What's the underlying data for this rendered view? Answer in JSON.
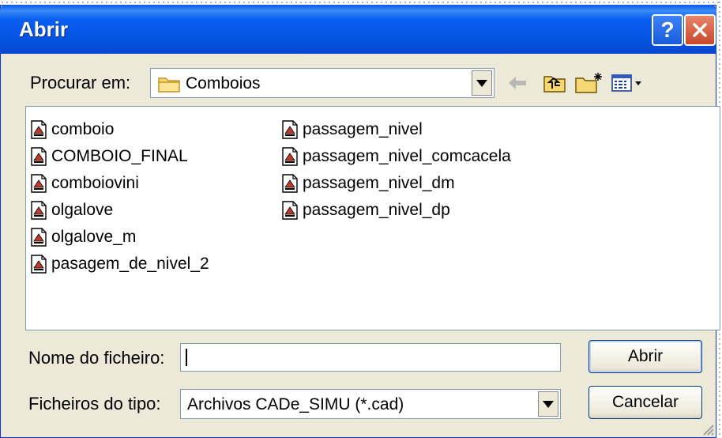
{
  "window": {
    "title": "Abrir",
    "help_icon": "?",
    "close_icon": "close-icon"
  },
  "lookin": {
    "label": "Procurar em:",
    "value": "Comboios",
    "icon": "folder-icon"
  },
  "toolbar": {
    "back_icon": "back-arrow-icon",
    "up_icon": "up-folder-icon",
    "new_folder_icon": "new-folder-icon",
    "view_menu_icon": "view-menu-icon"
  },
  "files": {
    "column1": [
      "comboio",
      "COMBOIO_FINAL",
      "comboiovini",
      "olgalove",
      "olgalove_m",
      "pasagem_de_nivel_2"
    ],
    "column2": [
      "passagem_nivel",
      "passagem_nivel_comcacela",
      "passagem_nivel_dm",
      "passagem_nivel_dp"
    ]
  },
  "filename": {
    "label": "Nome do ficheiro:",
    "value": ""
  },
  "filetype": {
    "label": "Ficheiros do tipo:",
    "value": "Archivos CADe_SIMU (*.cad)"
  },
  "buttons": {
    "open": "Abrir",
    "cancel": "Cancelar"
  },
  "colors": {
    "titlebar": "#0553e4",
    "dialog_bg": "#ece9d8",
    "close_button": "#c9482b"
  }
}
